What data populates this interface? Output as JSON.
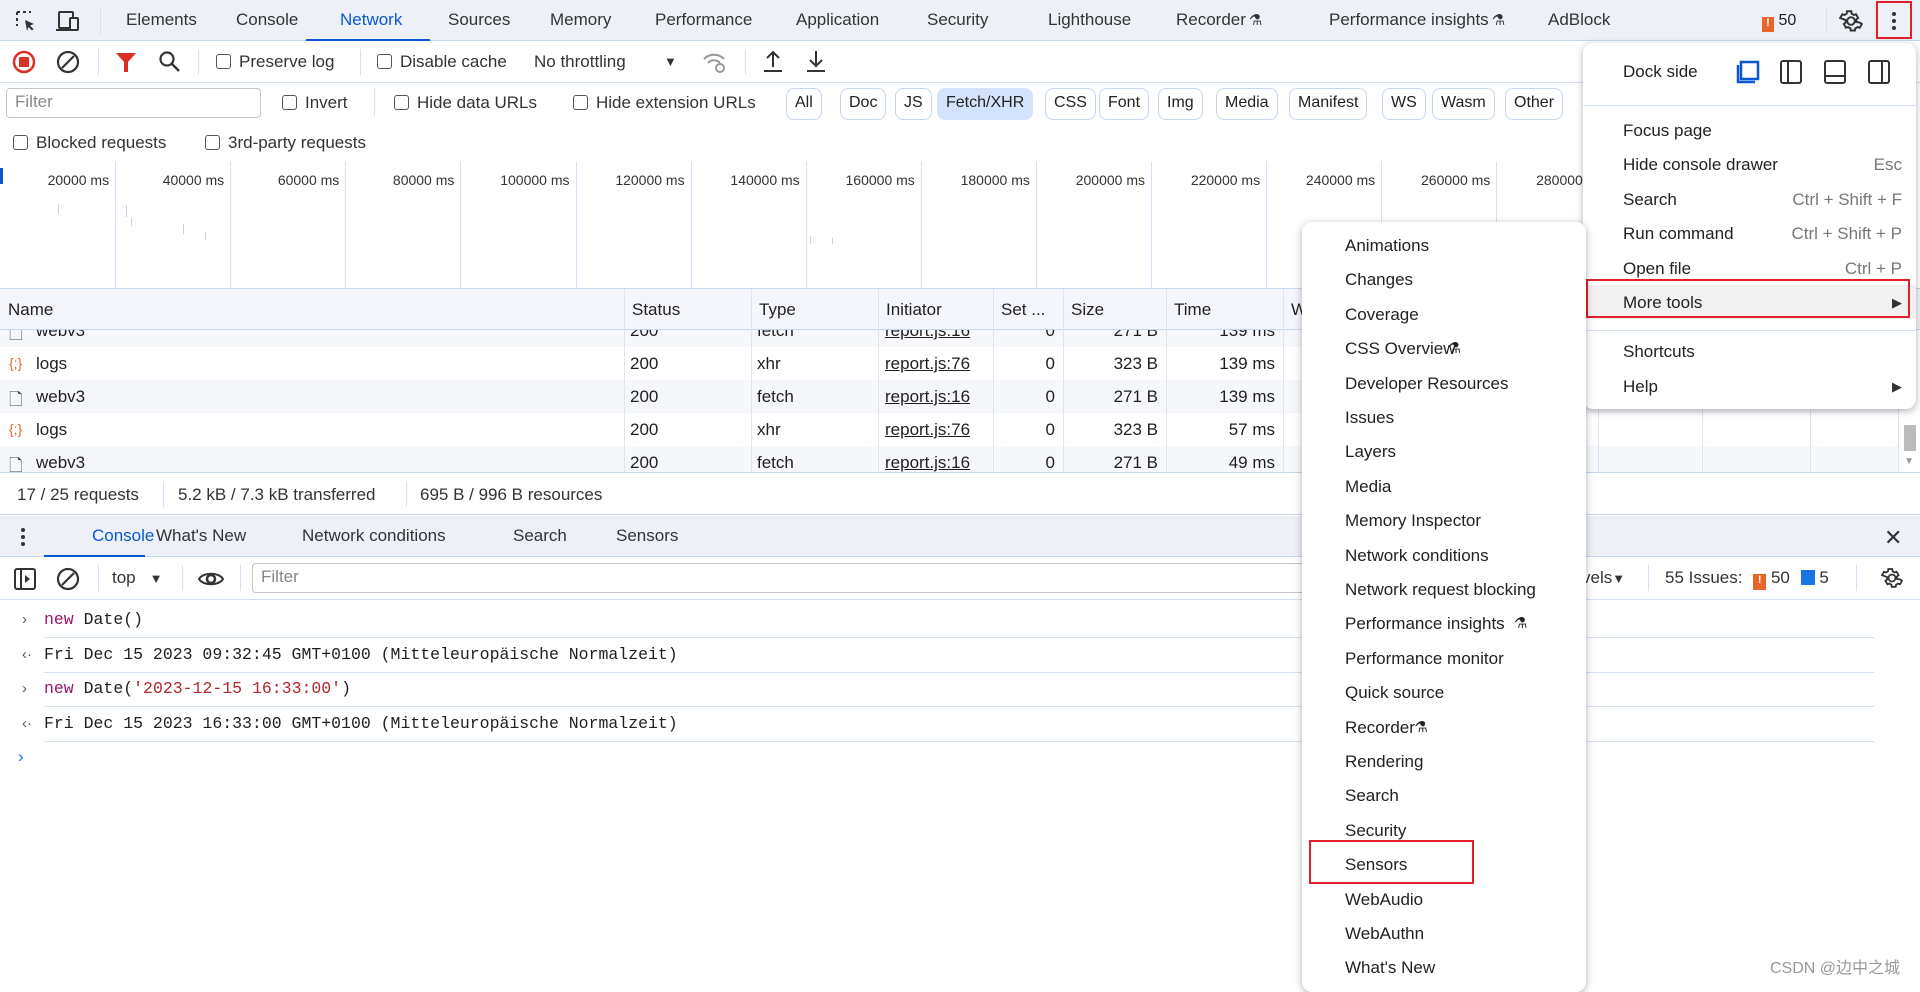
{
  "main_tabs": [
    "Elements",
    "Console",
    "Network",
    "Sources",
    "Memory",
    "Performance",
    "Application",
    "Security",
    "Lighthouse",
    "Recorder",
    "Performance insights",
    "AdBlock"
  ],
  "issues_badge": "50",
  "toolbar": {
    "preserve_log": "Preserve log",
    "disable_cache": "Disable cache",
    "throttling": "No throttling"
  },
  "filter": {
    "placeholder": "Filter",
    "invert": "Invert",
    "hide_data_urls": "Hide data URLs",
    "hide_extension_urls": "Hide extension URLs",
    "blocked": "Blocked requests",
    "third_party": "3rd-party requests"
  },
  "type_chips": [
    {
      "label": "All"
    },
    {
      "label": "Doc"
    },
    {
      "label": "JS"
    },
    {
      "label": "Fetch/XHR",
      "active": true
    },
    {
      "label": "CSS"
    },
    {
      "label": "Font"
    },
    {
      "label": "Img"
    },
    {
      "label": "Media"
    },
    {
      "label": "Manifest"
    },
    {
      "label": "WS"
    },
    {
      "label": "Wasm"
    },
    {
      "label": "Other"
    }
  ],
  "timeline_labels": [
    "20000 ms",
    "40000 ms",
    "60000 ms",
    "80000 ms",
    "100000 ms",
    "120000 ms",
    "140000 ms",
    "160000 ms",
    "180000 ms",
    "200000 ms",
    "220000 ms",
    "240000 ms",
    "260000 ms",
    "280000 ms"
  ],
  "table": {
    "columns": [
      "Name",
      "Status",
      "Type",
      "Initiator",
      "Set ...",
      "Size",
      "Time",
      "W"
    ],
    "rows": [
      {
        "icon": "document-icon",
        "name": "webv3",
        "status": "200",
        "type": "fetch",
        "initiator": "report.js:16",
        "set": "0",
        "size": "271 B",
        "time": "139 ms"
      },
      {
        "icon": "xhr-icon",
        "name": "logs",
        "status": "200",
        "type": "xhr",
        "initiator": "report.js:76",
        "set": "0",
        "size": "323 B",
        "time": "139 ms"
      },
      {
        "icon": "document-icon",
        "name": "webv3",
        "status": "200",
        "type": "fetch",
        "initiator": "report.js:16",
        "set": "0",
        "size": "271 B",
        "time": "139 ms"
      },
      {
        "icon": "xhr-icon",
        "name": "logs",
        "status": "200",
        "type": "xhr",
        "initiator": "report.js:76",
        "set": "0",
        "size": "323 B",
        "time": "57 ms"
      },
      {
        "icon": "document-icon",
        "name": "webv3",
        "status": "200",
        "type": "fetch",
        "initiator": "report.js:16",
        "set": "0",
        "size": "271 B",
        "time": "49 ms"
      }
    ]
  },
  "summary": {
    "requests": "17 / 25 requests",
    "transferred": "5.2 kB / 7.3 kB transferred",
    "resources": "695 B / 996 B resources"
  },
  "drawer_tabs": [
    "Console",
    "What's New",
    "Network conditions",
    "Search",
    "Sensors"
  ],
  "console": {
    "context": "top",
    "filter_placeholder": "Filter",
    "levels": "vels",
    "issues_label": "55 Issues:",
    "issues_warn": "50",
    "issues_info": "5",
    "lines": [
      {
        "kind": "input",
        "kw": "new",
        "rest": " Date()",
        "str": "",
        "tail": ""
      },
      {
        "kind": "output",
        "text": "Fri Dec 15 2023 09:32:45 GMT+0100 (Mitteleuropäische Normalzeit)"
      },
      {
        "kind": "input",
        "kw": "new",
        "rest": " Date(",
        "str": "'2023-12-15 16:33:00'",
        "tail": ")"
      },
      {
        "kind": "output",
        "text": "Fri Dec 15 2023 16:33:00 GMT+0100 (Mitteleuropäische Normalzeit)"
      }
    ]
  },
  "main_menu": {
    "dock_side": "Dock side",
    "items": [
      {
        "label": "Focus page",
        "shortcut": ""
      },
      {
        "label": "Hide console drawer",
        "shortcut": "Esc"
      },
      {
        "label": "Search",
        "shortcut": "Ctrl + Shift + F"
      },
      {
        "label": "Run command",
        "shortcut": "Ctrl + Shift + P"
      },
      {
        "label": "Open file",
        "shortcut": "Ctrl + P"
      },
      {
        "label": "More tools",
        "shortcut": "",
        "submenu": true,
        "highlighted": true
      }
    ],
    "items2": [
      {
        "label": "Shortcuts",
        "submenu": false
      },
      {
        "label": "Help",
        "submenu": true
      }
    ]
  },
  "more_tools": [
    "Animations",
    "Changes",
    "Coverage",
    "CSS Overview",
    "Developer Resources",
    "Issues",
    "Layers",
    "Media",
    "Memory Inspector",
    "Network conditions",
    "Network request blocking",
    "Performance insights",
    "Performance monitor",
    "Quick source",
    "Recorder",
    "Rendering",
    "Search",
    "Security",
    "Sensors",
    "WebAudio",
    "WebAuthn",
    "What's New"
  ],
  "experimental_tools": [
    "CSS Overview",
    "Performance insights",
    "Recorder"
  ],
  "highlighted_tool": "Sensors",
  "watermark": "CSDN @边中之城",
  "colors": {
    "accent": "#0b57d0",
    "record": "#d93025",
    "highlight_box": "#e0202a",
    "warning": "#e8652b",
    "chip_active": "#d3e3fd"
  }
}
